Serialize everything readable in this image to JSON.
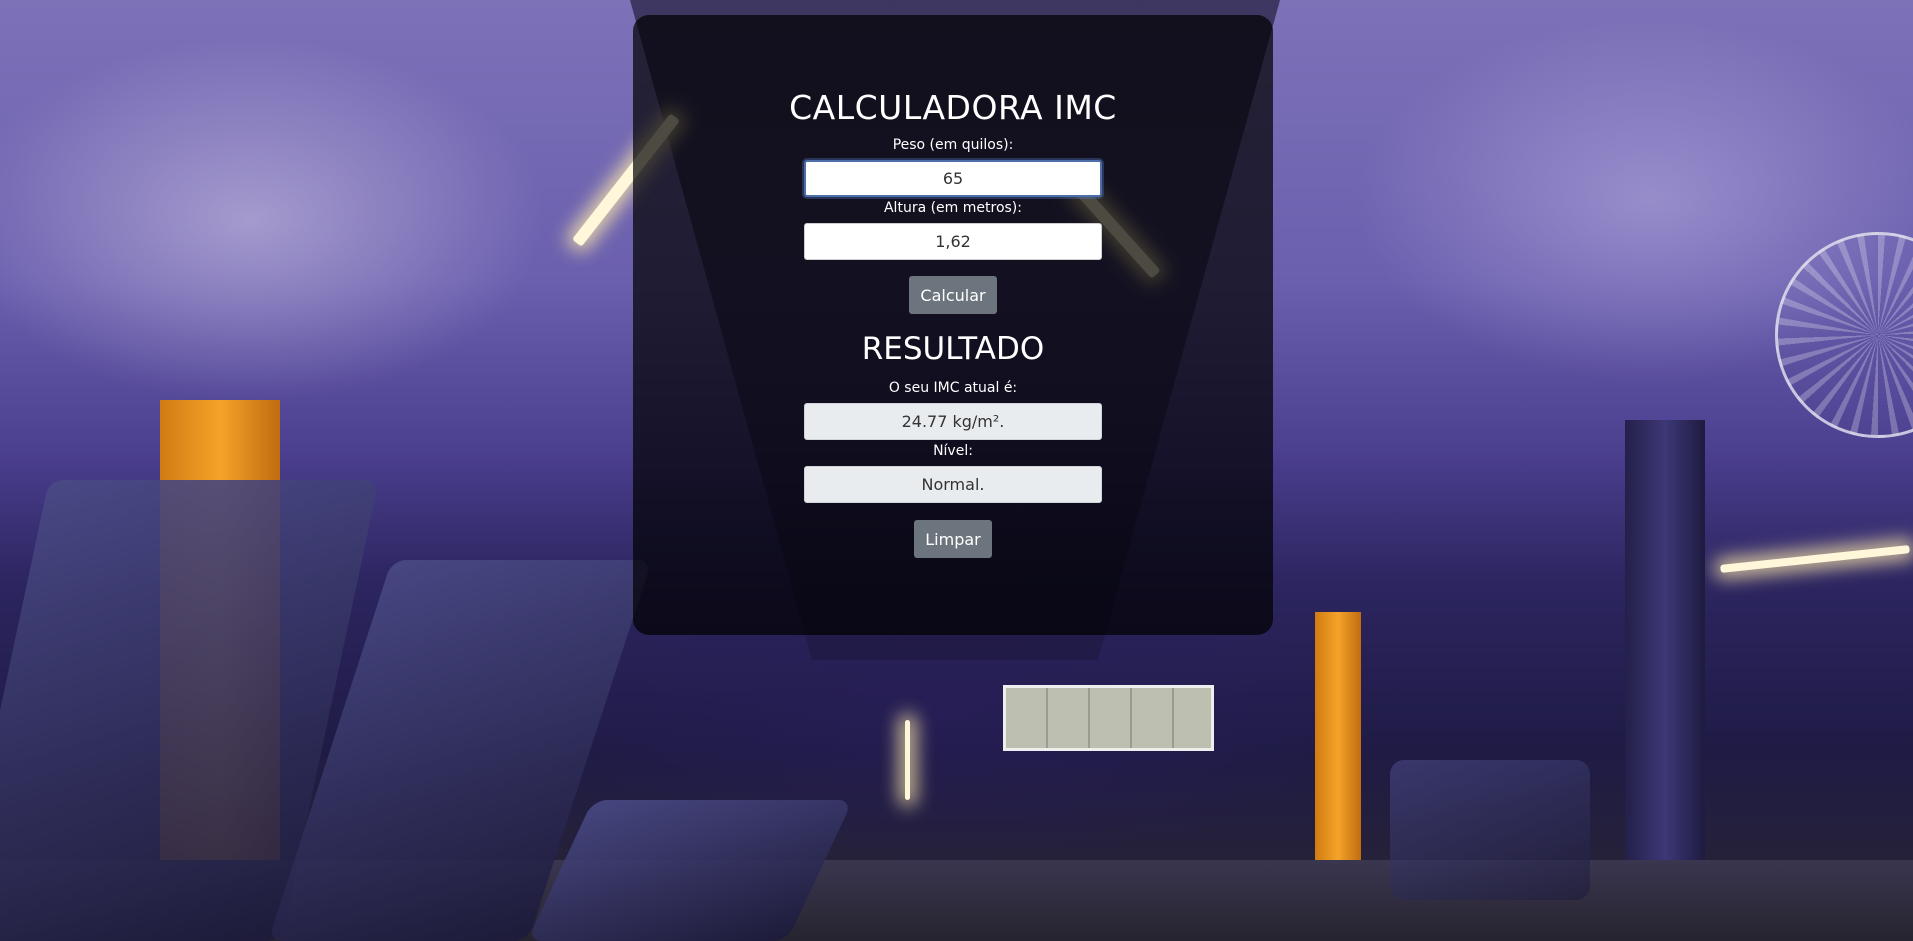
{
  "app": {
    "title": "CALCULADORA IMC",
    "weight_label": "Peso (em quilos):",
    "weight_value": "65",
    "height_label": "Altura (em metros):",
    "height_value": "1,62",
    "calculate_button": "Calcular",
    "result_title": "RESULTADO",
    "bmi_label": "O seu IMC atual é:",
    "bmi_value": "24.77 kg/m².",
    "level_label": "Nível:",
    "level_value": "Normal.",
    "clear_button": "Limpar"
  },
  "colors": {
    "card_background": "rgba(0,0,0,0.7)",
    "button": "#6c757d",
    "readonly_field": "#e9ecef",
    "focus_border": "#4d6fa8"
  }
}
